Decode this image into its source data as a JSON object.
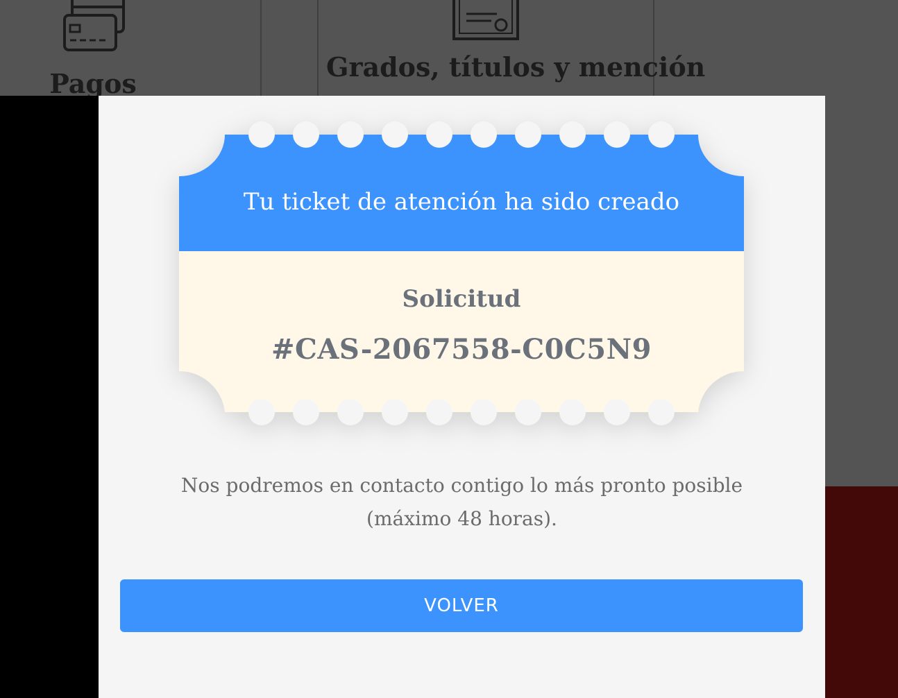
{
  "background": {
    "tiles": [
      {
        "label": "Pagos",
        "icon": "credit-card-icon"
      },
      {
        "label": "Grados, títulos y mención",
        "icon": "certificate-icon"
      }
    ]
  },
  "ticket": {
    "header": "Tu ticket de atención ha sido creado",
    "label": "Solicitud",
    "code": "#CAS-2067558-C0C5N9"
  },
  "message": {
    "line1": "Nos podremos en contacto contigo lo más pronto posible",
    "line2": "(máximo 48 horas)."
  },
  "actions": {
    "back_label": "VOLVER"
  },
  "colors": {
    "primary": "#3d93fe",
    "ticket_body": "#fff8e8",
    "modal_bg": "#f5f5f5",
    "overlay": "#545454",
    "text_muted": "#6b717b"
  }
}
